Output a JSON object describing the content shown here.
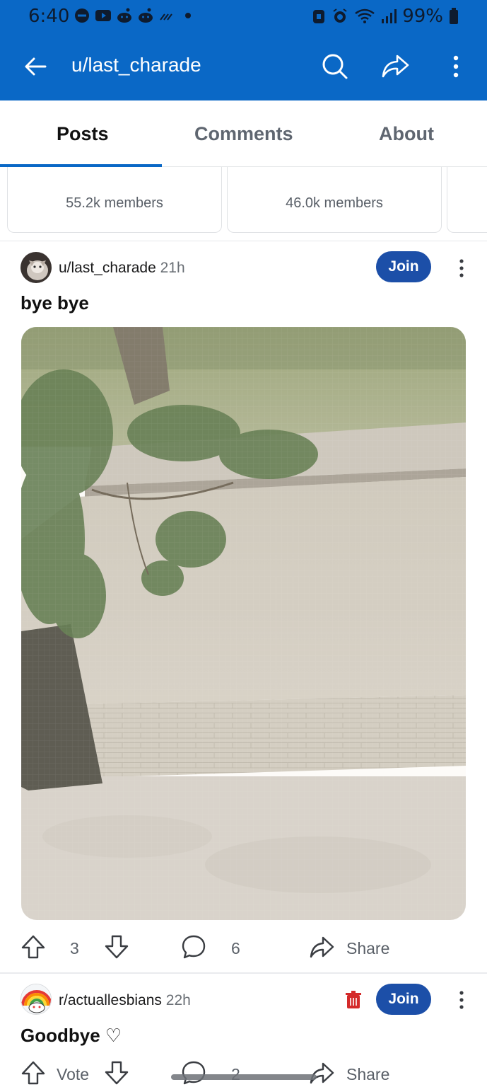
{
  "status_bar": {
    "time": "6:40",
    "battery": "99%",
    "icons": [
      "minus-circle-icon",
      "youtube-icon",
      "reddit-icon",
      "reddit-icon",
      "signal-slash-icon",
      "dot-icon",
      "lock-icon",
      "alarm-icon",
      "wifi-icon",
      "cell-signal-icon",
      "battery-icon"
    ]
  },
  "app_bar": {
    "title": "u/last_charade",
    "back_icon": "arrow-left-icon",
    "search_icon": "search-icon",
    "share_icon": "share-icon",
    "more_icon": "more-vertical-icon"
  },
  "tabs": [
    {
      "label": "Posts",
      "active": true
    },
    {
      "label": "Comments",
      "active": false
    },
    {
      "label": "About",
      "active": false
    }
  ],
  "community_cards": [
    {
      "members": "55.2k members"
    },
    {
      "members": "46.0k members"
    }
  ],
  "posts": [
    {
      "author": "u/last_charade",
      "age": "21h",
      "join_label": "Join",
      "title": "bye bye",
      "media_alt": "Photo of a paved sidewalk with a tree trunk and leafy branches",
      "upvotes": "3",
      "comments": "6",
      "share_label": "Share"
    },
    {
      "author": "r/actuallesbians",
      "age": "22h",
      "join_label": "Join",
      "title": "Goodbye ♡",
      "vote_label": "Vote",
      "comments": "2",
      "share_label": "Share"
    }
  ],
  "colors": {
    "brand_blue": "#0a68c6",
    "join_blue": "#1c4fa8",
    "delete_red": "#d42a2a"
  }
}
